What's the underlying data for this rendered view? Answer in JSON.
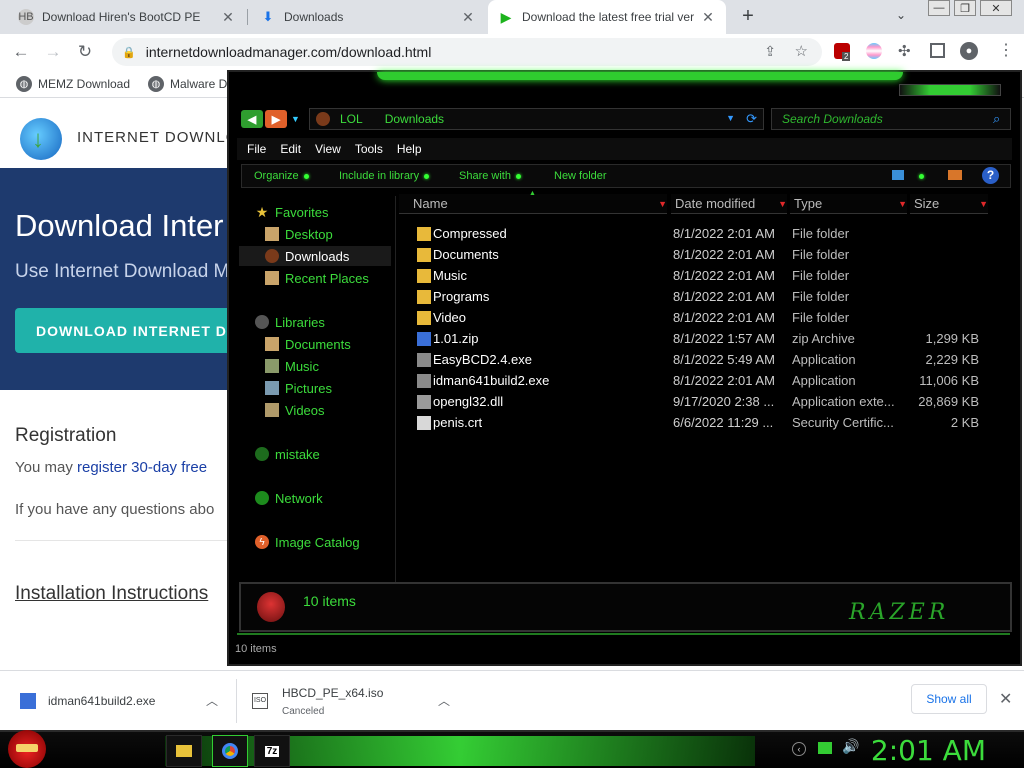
{
  "browser": {
    "tabs": [
      {
        "title": "Download Hiren's BootCD PE",
        "icon": "hirens-icon"
      },
      {
        "title": "Downloads",
        "icon": "download-icon"
      },
      {
        "title": "Download the latest free trial ver",
        "icon": "play-icon"
      }
    ],
    "new_tab": "+",
    "url": "internetdownloadmanager.com/download.html",
    "bookmarks": [
      {
        "label": "MEMZ Download"
      },
      {
        "label": "Malware D"
      }
    ],
    "extension_badge": "2"
  },
  "site": {
    "brand": "INTERNET DOWNLO",
    "hero_title": "Download Inter",
    "hero_sub": "Use Internet Download M",
    "download_button": "DOWNLOAD INTERNET DO",
    "registration_heading": "Registration",
    "reg_text_prefix": "You may ",
    "reg_link": "register 30-day free",
    "questions_text": "If you have any questions abo",
    "install_heading": "Installation Instructions"
  },
  "explorer": {
    "breadcrumb": [
      "LOL",
      "Downloads"
    ],
    "search_placeholder": "Search Downloads",
    "menu": [
      "File",
      "Edit",
      "View",
      "Tools",
      "Help"
    ],
    "commands": [
      "Organize",
      "Include in library",
      "Share with",
      "New folder"
    ],
    "nav": {
      "favorites": "Favorites",
      "fav_items": [
        "Desktop",
        "Downloads",
        "Recent Places"
      ],
      "libraries": "Libraries",
      "lib_items": [
        "Documents",
        "Music",
        "Pictures",
        "Videos"
      ],
      "mistake": "mistake",
      "network": "Network",
      "image_catalog": "Image Catalog"
    },
    "columns": [
      "Name",
      "Date modified",
      "Type",
      "Size"
    ],
    "files": [
      {
        "name": "Compressed",
        "date": "8/1/2022 2:01 AM",
        "type": "File folder",
        "size": "",
        "icon": "folder-icon"
      },
      {
        "name": "Documents",
        "date": "8/1/2022 2:01 AM",
        "type": "File folder",
        "size": "",
        "icon": "folder-icon"
      },
      {
        "name": "Music",
        "date": "8/1/2022 2:01 AM",
        "type": "File folder",
        "size": "",
        "icon": "folder-icon"
      },
      {
        "name": "Programs",
        "date": "8/1/2022 2:01 AM",
        "type": "File folder",
        "size": "",
        "icon": "folder-icon"
      },
      {
        "name": "Video",
        "date": "8/1/2022 2:01 AM",
        "type": "File folder",
        "size": "",
        "icon": "folder-icon"
      },
      {
        "name": "1.01.zip",
        "date": "8/1/2022 1:57 AM",
        "type": "zip Archive",
        "size": "1,299 KB",
        "icon": "zip-icon"
      },
      {
        "name": "EasyBCD2.4.exe",
        "date": "8/1/2022 5:49 AM",
        "type": "Application",
        "size": "2,229 KB",
        "icon": "exe-icon"
      },
      {
        "name": "idman641build2.exe",
        "date": "8/1/2022 2:01 AM",
        "type": "Application",
        "size": "11,006 KB",
        "icon": "exe-icon"
      },
      {
        "name": "opengl32.dll",
        "date": "9/17/2020 2:38 ...",
        "type": "Application exte...",
        "size": "28,869 KB",
        "icon": "dll-icon"
      },
      {
        "name": "penis.crt",
        "date": "6/6/2022 11:29 ...",
        "type": "Security Certific...",
        "size": "2 KB",
        "icon": "certificate-icon"
      }
    ],
    "details_count": "10 items",
    "logo": "RAZER",
    "status": "10 items"
  },
  "shelf": {
    "items": [
      {
        "name": "idman641build2.exe",
        "status": ""
      },
      {
        "name": "HBCD_PE_x64.iso",
        "status": "Canceled"
      }
    ],
    "show_all": "Show all"
  },
  "taskbar": {
    "clock": "2:01 AM"
  },
  "colors": {
    "accent_green": "#3cdc3c",
    "hero_blue": "#1e3a6e",
    "button_teal": "#20b2aa"
  }
}
